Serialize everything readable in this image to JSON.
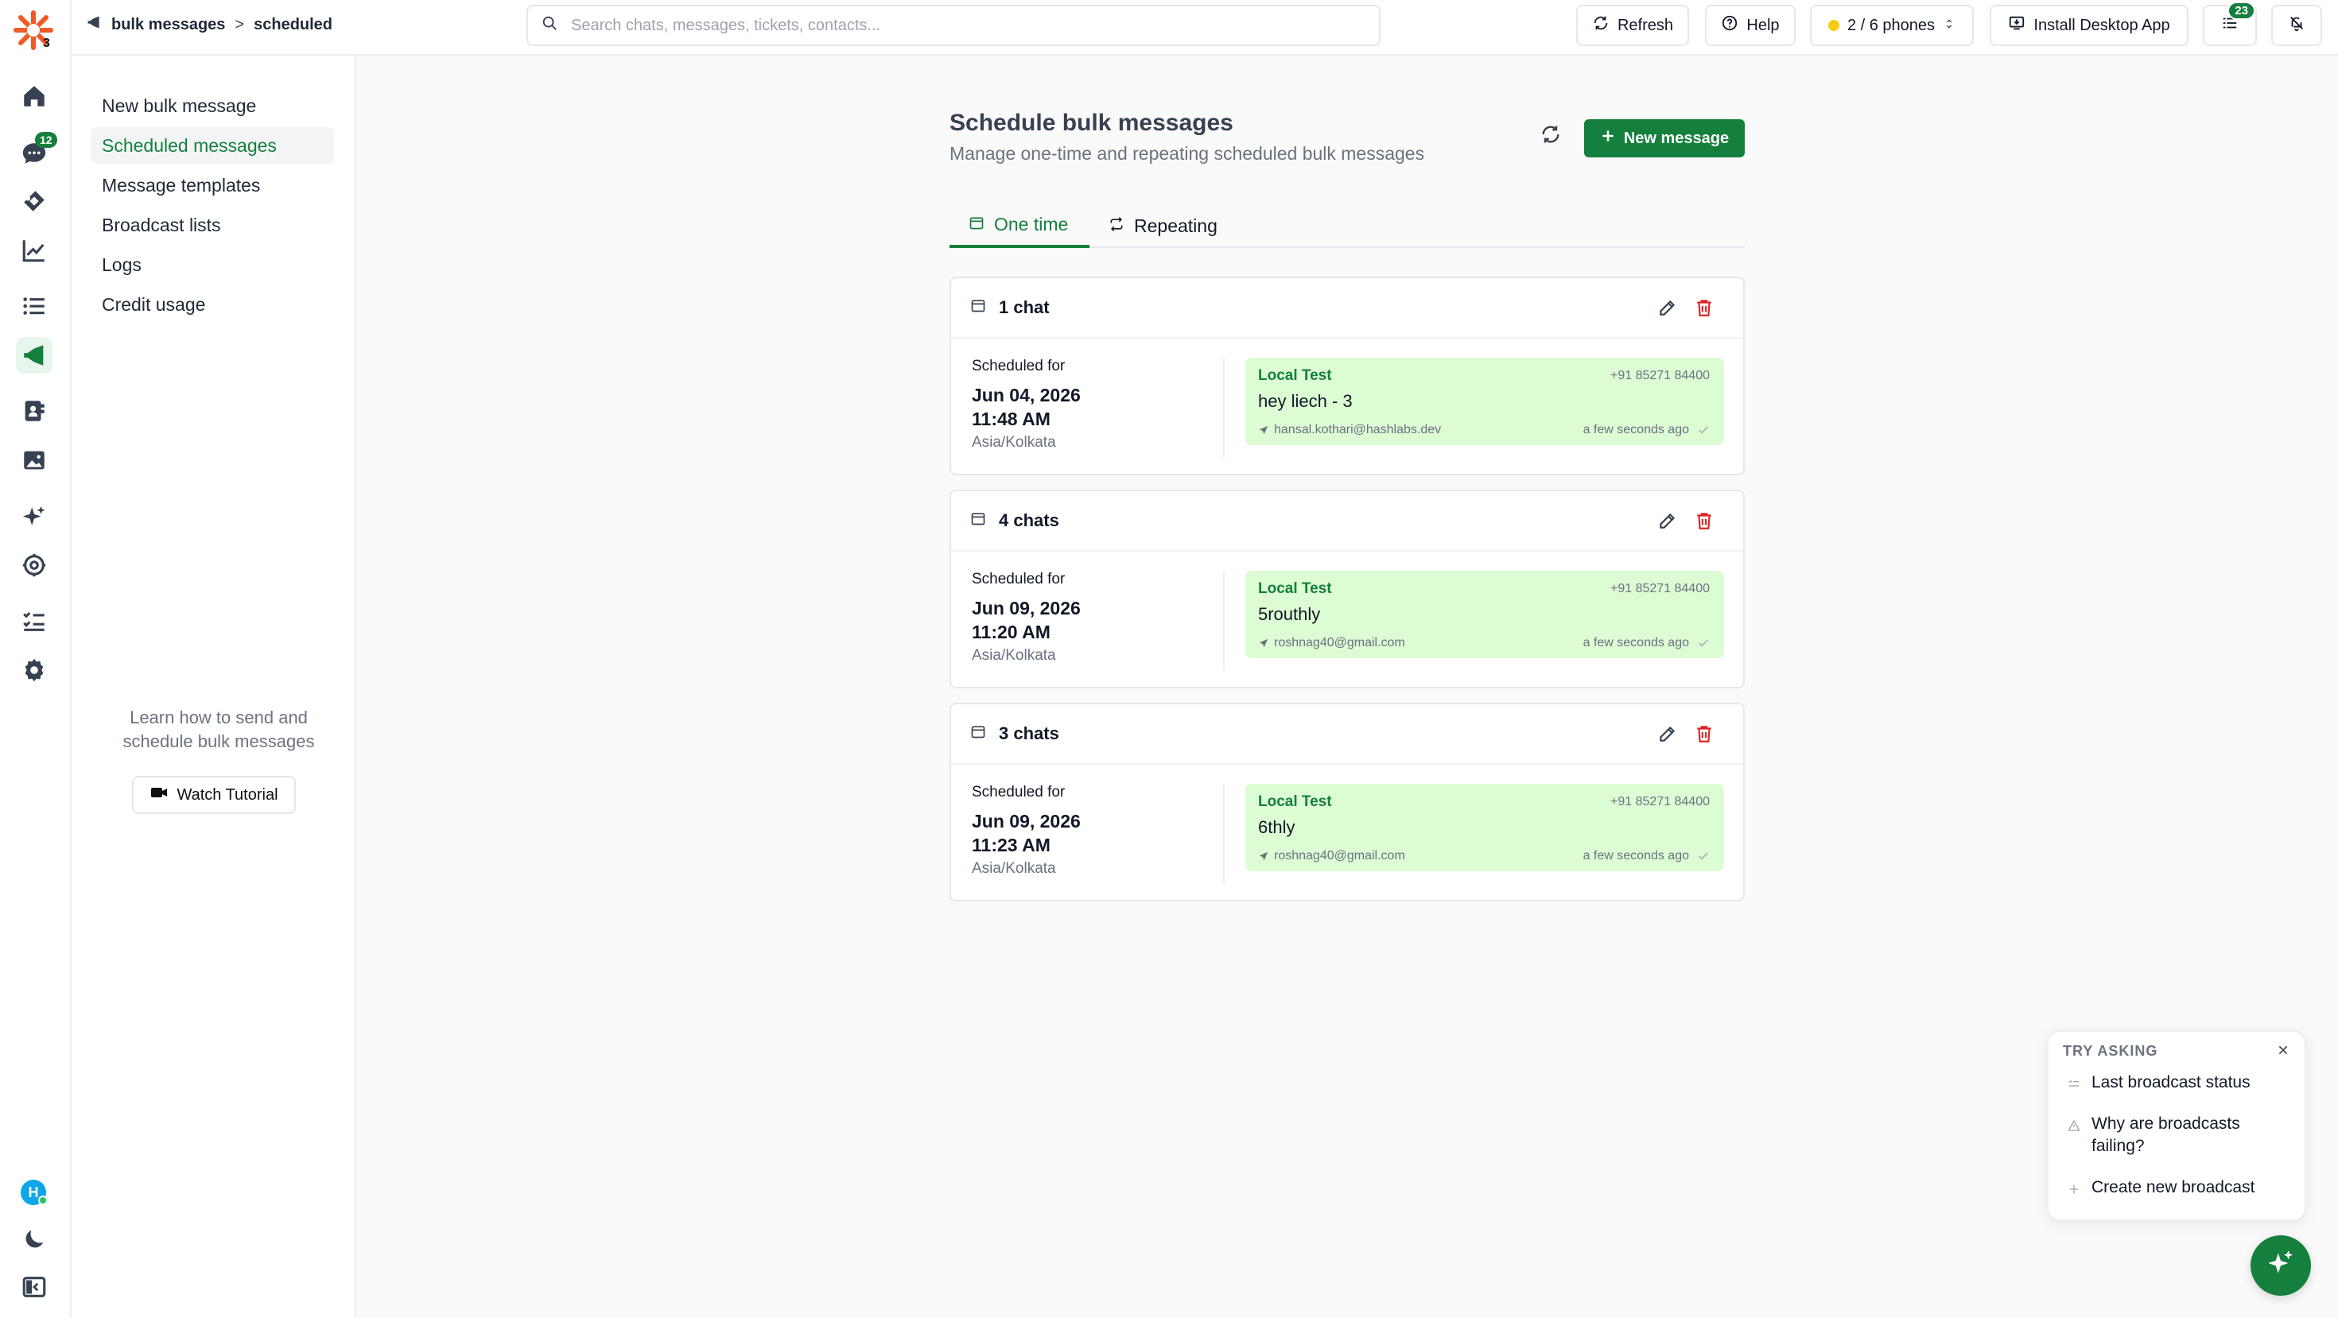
{
  "app": {
    "logo_badge": "3",
    "brand_color": "#15803d"
  },
  "rail": {
    "chat_badge": "12",
    "avatar_initial": "H",
    "icons": [
      "home-icon",
      "chat-icon",
      "ticket-icon",
      "analytics-icon",
      "list-icon",
      "megaphone-icon",
      "contacts-icon",
      "media-icon",
      "sparkles-icon",
      "integrations-icon",
      "tasks-icon",
      "settings-icon",
      "moon-icon",
      "sidebar-toggle-icon"
    ]
  },
  "topbar": {
    "breadcrumb": {
      "root": "bulk messages",
      "separator": ">",
      "current": "scheduled"
    },
    "search_placeholder": "Search chats, messages, tickets, contacts...",
    "refresh_label": "Refresh",
    "help_label": "Help",
    "phones_label": "2 / 6 phones",
    "install_label": "Install Desktop App",
    "tasks_badge": "23"
  },
  "subnav": {
    "items": [
      {
        "label": "New bulk message"
      },
      {
        "label": "Scheduled messages"
      },
      {
        "label": "Message templates"
      },
      {
        "label": "Broadcast lists"
      },
      {
        "label": "Logs"
      },
      {
        "label": "Credit usage"
      }
    ],
    "tutorial_text": "Learn how to send and schedule bulk messages",
    "tutorial_button": "Watch Tutorial"
  },
  "main": {
    "title": "Schedule bulk messages",
    "subtitle": "Manage one-time and repeating scheduled bulk messages",
    "new_message_label": "New message",
    "tabs": [
      {
        "label": "One time"
      },
      {
        "label": "Repeating"
      }
    ],
    "cards": [
      {
        "chats": "1 chat",
        "scheduled_label": "Scheduled for",
        "date": "Jun 04, 2026",
        "time": "11:48 AM",
        "timezone": "Asia/Kolkata",
        "bubble": {
          "name": "Local Test",
          "phone": "+91 85271 84400",
          "text": "hey liech - 3",
          "sender": "hansal.kothari@hashlabs.dev",
          "time": "a few seconds ago"
        }
      },
      {
        "chats": "4 chats",
        "scheduled_label": "Scheduled for",
        "date": "Jun 09, 2026",
        "time": "11:20 AM",
        "timezone": "Asia/Kolkata",
        "bubble": {
          "name": "Local Test",
          "phone": "+91 85271 84400",
          "text": "5routhly",
          "sender": "roshnag40@gmail.com",
          "time": "a few seconds ago"
        }
      },
      {
        "chats": "3 chats",
        "scheduled_label": "Scheduled for",
        "date": "Jun 09, 2026",
        "time": "11:23 AM",
        "timezone": "Asia/Kolkata",
        "bubble": {
          "name": "Local Test",
          "phone": "+91 85271 84400",
          "text": "6thly",
          "sender": "roshnag40@gmail.com",
          "time": "a few seconds ago"
        }
      }
    ]
  },
  "assistant": {
    "title": "TRY ASKING",
    "suggestions": [
      {
        "label": "Last broadcast status"
      },
      {
        "label": "Why are broadcasts failing?"
      },
      {
        "label": "Create new broadcast"
      }
    ]
  }
}
